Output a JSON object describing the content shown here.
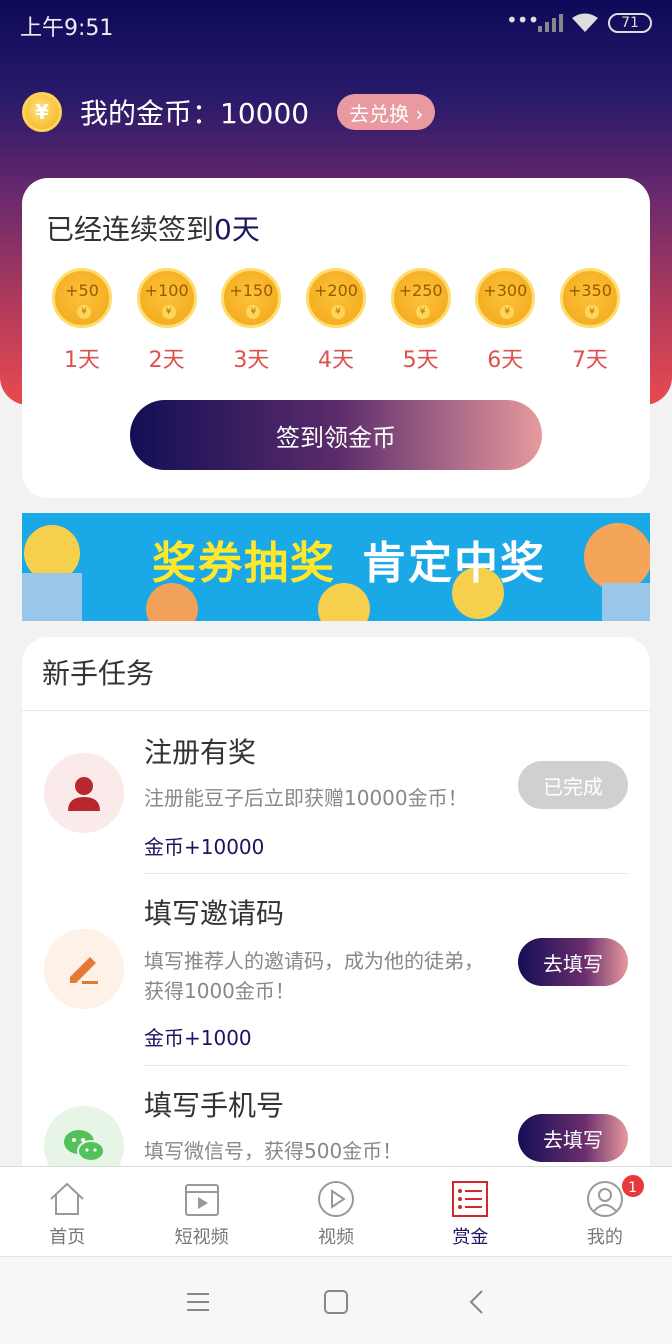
{
  "status": {
    "time": "上午9:51",
    "dots": "•••",
    "battery": "71"
  },
  "coins": {
    "icon": "yen-coin-icon",
    "yen_symbol": "¥",
    "label": "我的金币：10000",
    "exchange": "去兑换 ›"
  },
  "signin": {
    "title_prefix": "已经连续签到",
    "days": "0天",
    "rewards": [
      {
        "amount": "+50",
        "day": "1天"
      },
      {
        "amount": "+100",
        "day": "2天"
      },
      {
        "amount": "+150",
        "day": "3天"
      },
      {
        "amount": "+200",
        "day": "4天"
      },
      {
        "amount": "+250",
        "day": "5天"
      },
      {
        "amount": "+300",
        "day": "6天"
      },
      {
        "amount": "+350",
        "day": "7天"
      }
    ],
    "coin_mark": "¥",
    "button": "签到领金币"
  },
  "banner": {
    "text_yellow": "奖券抽奖",
    "text_white": "肯定中奖"
  },
  "tasks": {
    "header": "新手任务",
    "items": [
      {
        "title": "注册有奖",
        "desc": "注册能豆子后立即获赠10000金币！",
        "reward": "金币+10000",
        "button": "已完成",
        "icon": "user-icon"
      },
      {
        "title": "填写邀请码",
        "desc": "填写推荐人的邀请码，成为他的徒弟，获得1000金币！",
        "reward": "金币+1000",
        "button": "去填写",
        "icon": "pencil-icon"
      },
      {
        "title": "填写手机号",
        "desc": "填写微信号，获得500金币！",
        "button": "去填写",
        "icon": "wechat-icon"
      }
    ]
  },
  "tabbar": {
    "items": [
      {
        "label": "首页",
        "icon": "home-icon"
      },
      {
        "label": "短视频",
        "icon": "short-video-icon"
      },
      {
        "label": "视频",
        "icon": "play-icon"
      },
      {
        "label": "赏金",
        "icon": "list-icon",
        "active": true
      },
      {
        "label": "我的",
        "icon": "profile-icon",
        "badge": "1"
      }
    ]
  },
  "colors": {
    "accent": "#1a1560",
    "red": "#e0504c",
    "gold": "#f3a51a"
  }
}
